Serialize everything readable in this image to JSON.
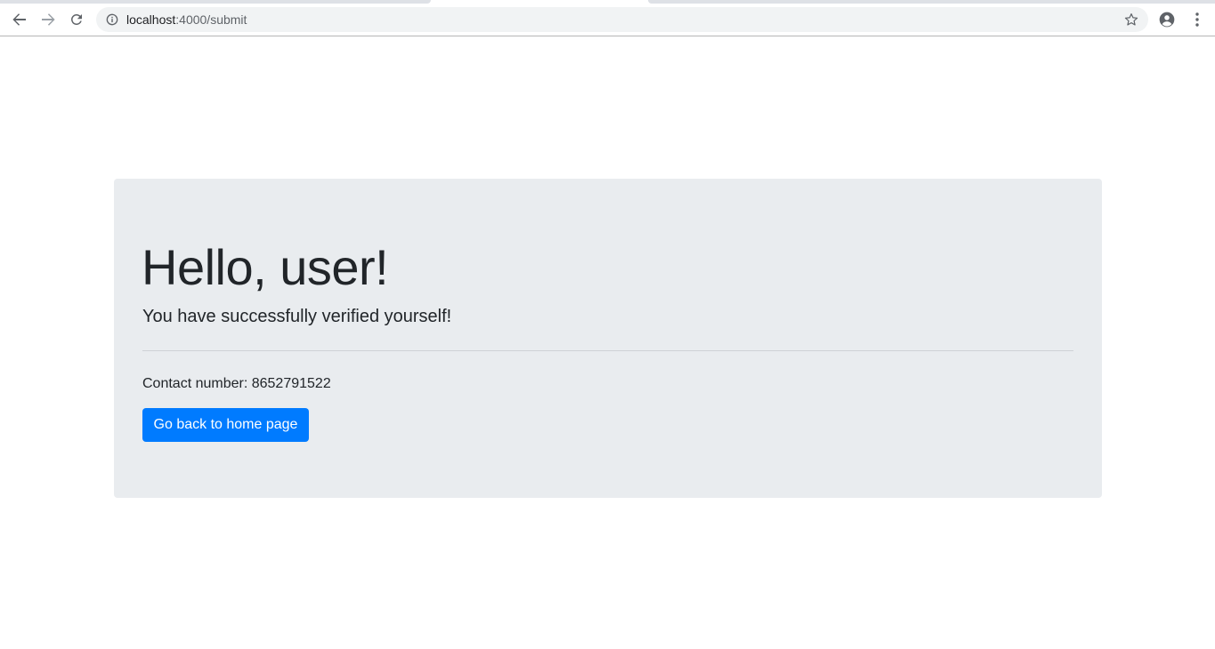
{
  "browser": {
    "url_host": "localhost",
    "url_path": ":4000/submit",
    "icons": {
      "back": "back-arrow-icon",
      "forward": "forward-arrow-icon",
      "reload": "reload-icon",
      "info": "info-icon",
      "bookmark": "star-icon",
      "profile": "account-circle-icon",
      "menu": "kebab-menu-icon"
    }
  },
  "page": {
    "heading": "Hello, user!",
    "lead": "You have successfully verified yourself!",
    "contact": "Contact number: 8652791522",
    "button_label": "Go back to home page"
  },
  "colors": {
    "jumbotron_bg": "#e9ecef",
    "button_bg": "#007bff",
    "text": "#212529"
  }
}
